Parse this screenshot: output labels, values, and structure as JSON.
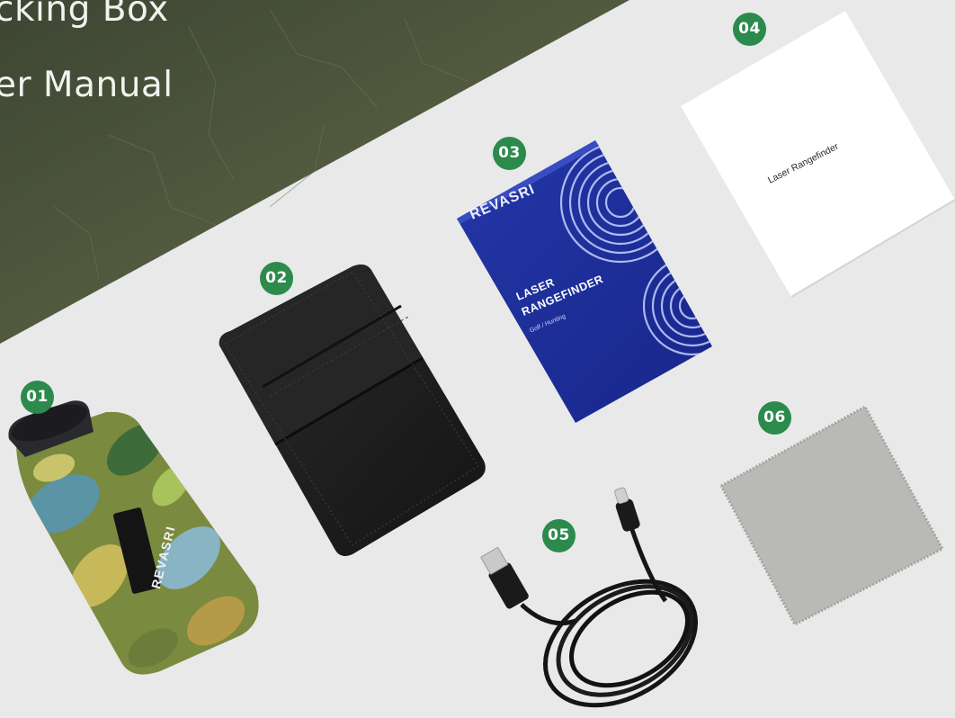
{
  "header": {
    "line_1": "cking Box",
    "line_2": "er Manual"
  },
  "badges": [
    "01",
    "02",
    "03",
    "04",
    "05",
    "06"
  ],
  "products": {
    "rangefinder_device": {
      "brand_print": "REVASRI"
    },
    "carry_pouch": {},
    "retail_box": {
      "brand_print": "REVASRI",
      "title_line_1": "LASER",
      "title_line_2": "RANGEFINDER",
      "subtitle": "Golf / Hunting"
    },
    "user_manual": {
      "title_print": "Laser Rangefinder"
    },
    "usb_cable": {},
    "cleaning_cloth": {}
  },
  "colors": {
    "backdrop": "#e9e9ea",
    "header_banner": "#4a5238",
    "header_text": "#f2f2ee",
    "badge_green": "#2b8a4c",
    "box_blue": "#1e2f9c",
    "pouch_black": "#1e1e1e",
    "cloth_gray": "#b9b9b6"
  }
}
